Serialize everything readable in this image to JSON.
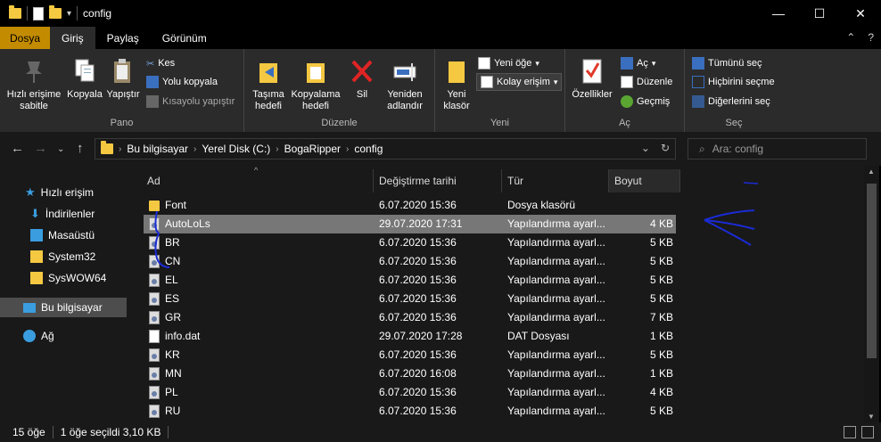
{
  "window": {
    "title": "config",
    "controls": {
      "minimize": "—",
      "maximize": "☐",
      "close": "✕"
    }
  },
  "ribbon_tabs": [
    "Dosya",
    "Giriş",
    "Paylaş",
    "Görünüm"
  ],
  "ribbon": {
    "pano": {
      "label": "Pano",
      "pin": "Hızlı erişime sabitle",
      "copy": "Kopyala",
      "paste": "Yapıştır",
      "cut": "Kes",
      "copy_path": "Yolu kopyala",
      "paste_shortcut": "Kısayolu yapıştır"
    },
    "duzenle": {
      "label": "Düzenle",
      "move_to": "Taşıma hedefi",
      "copy_to": "Kopyalama hedefi",
      "delete": "Sil",
      "rename": "Yeniden adlandır"
    },
    "yeni": {
      "label": "Yeni",
      "new_folder": "Yeni klasör",
      "new_item": "Yeni öğe",
      "easy_access": "Kolay erişim"
    },
    "ac": {
      "label": "Aç",
      "properties": "Özellikler",
      "open": "Aç",
      "edit": "Düzenle",
      "history": "Geçmiş"
    },
    "sec": {
      "label": "Seç",
      "select_all": "Tümünü seç",
      "select_none": "Hiçbirini seçme",
      "invert": "Diğerlerini seç"
    }
  },
  "address": {
    "crumbs": [
      "Bu bilgisayar",
      "Yerel Disk (C:)",
      "BogaRipper",
      "config"
    ],
    "search_placeholder": "Ara: config"
  },
  "nav_pane": {
    "items": [
      {
        "label": "Hızlı erişim",
        "icon": "star-icon"
      },
      {
        "label": "İndirilenler",
        "icon": "download-arrow-icon"
      },
      {
        "label": "Masaüstü",
        "icon": "desktop-icon"
      },
      {
        "label": "System32",
        "icon": "folder-icon"
      },
      {
        "label": "SysWOW64",
        "icon": "folder-icon"
      },
      {
        "label": "Bu bilgisayar",
        "icon": "computer-icon"
      },
      {
        "label": "Ağ",
        "icon": "network-icon"
      }
    ]
  },
  "columns": [
    "Ad",
    "Değiştirme tarihi",
    "Tür",
    "Boyut"
  ],
  "files": [
    {
      "name": "Font",
      "date": "6.07.2020 15:36",
      "type": "Dosya klasörü",
      "size": "",
      "kind": "folder"
    },
    {
      "name": "AutoLoLs",
      "date": "29.07.2020 17:31",
      "type": "Yapılandırma ayarl...",
      "size": "4 KB",
      "kind": "config",
      "selected": true
    },
    {
      "name": "BR",
      "date": "6.07.2020 15:36",
      "type": "Yapılandırma ayarl...",
      "size": "5 KB",
      "kind": "config"
    },
    {
      "name": "CN",
      "date": "6.07.2020 15:36",
      "type": "Yapılandırma ayarl...",
      "size": "5 KB",
      "kind": "config"
    },
    {
      "name": "EL",
      "date": "6.07.2020 15:36",
      "type": "Yapılandırma ayarl...",
      "size": "5 KB",
      "kind": "config"
    },
    {
      "name": "ES",
      "date": "6.07.2020 15:36",
      "type": "Yapılandırma ayarl...",
      "size": "5 KB",
      "kind": "config"
    },
    {
      "name": "GR",
      "date": "6.07.2020 15:36",
      "type": "Yapılandırma ayarl...",
      "size": "7 KB",
      "kind": "config"
    },
    {
      "name": "info.dat",
      "date": "29.07.2020 17:28",
      "type": "DAT Dosyası",
      "size": "1 KB",
      "kind": "doc"
    },
    {
      "name": "KR",
      "date": "6.07.2020 15:36",
      "type": "Yapılandırma ayarl...",
      "size": "5 KB",
      "kind": "config"
    },
    {
      "name": "MN",
      "date": "6.07.2020 16:08",
      "type": "Yapılandırma ayarl...",
      "size": "1 KB",
      "kind": "config"
    },
    {
      "name": "PL",
      "date": "6.07.2020 15:36",
      "type": "Yapılandırma ayarl...",
      "size": "4 KB",
      "kind": "config"
    },
    {
      "name": "RU",
      "date": "6.07.2020 15:36",
      "type": "Yapılandırma ayarl...",
      "size": "5 KB",
      "kind": "config"
    }
  ],
  "status": {
    "count": "15 öğe",
    "selection": "1 öğe seçildi  3,10 KB"
  },
  "colors": {
    "file_tab": "#c38c00",
    "selected_row": "#777777",
    "annotation_pen": "#1a2bd6"
  }
}
